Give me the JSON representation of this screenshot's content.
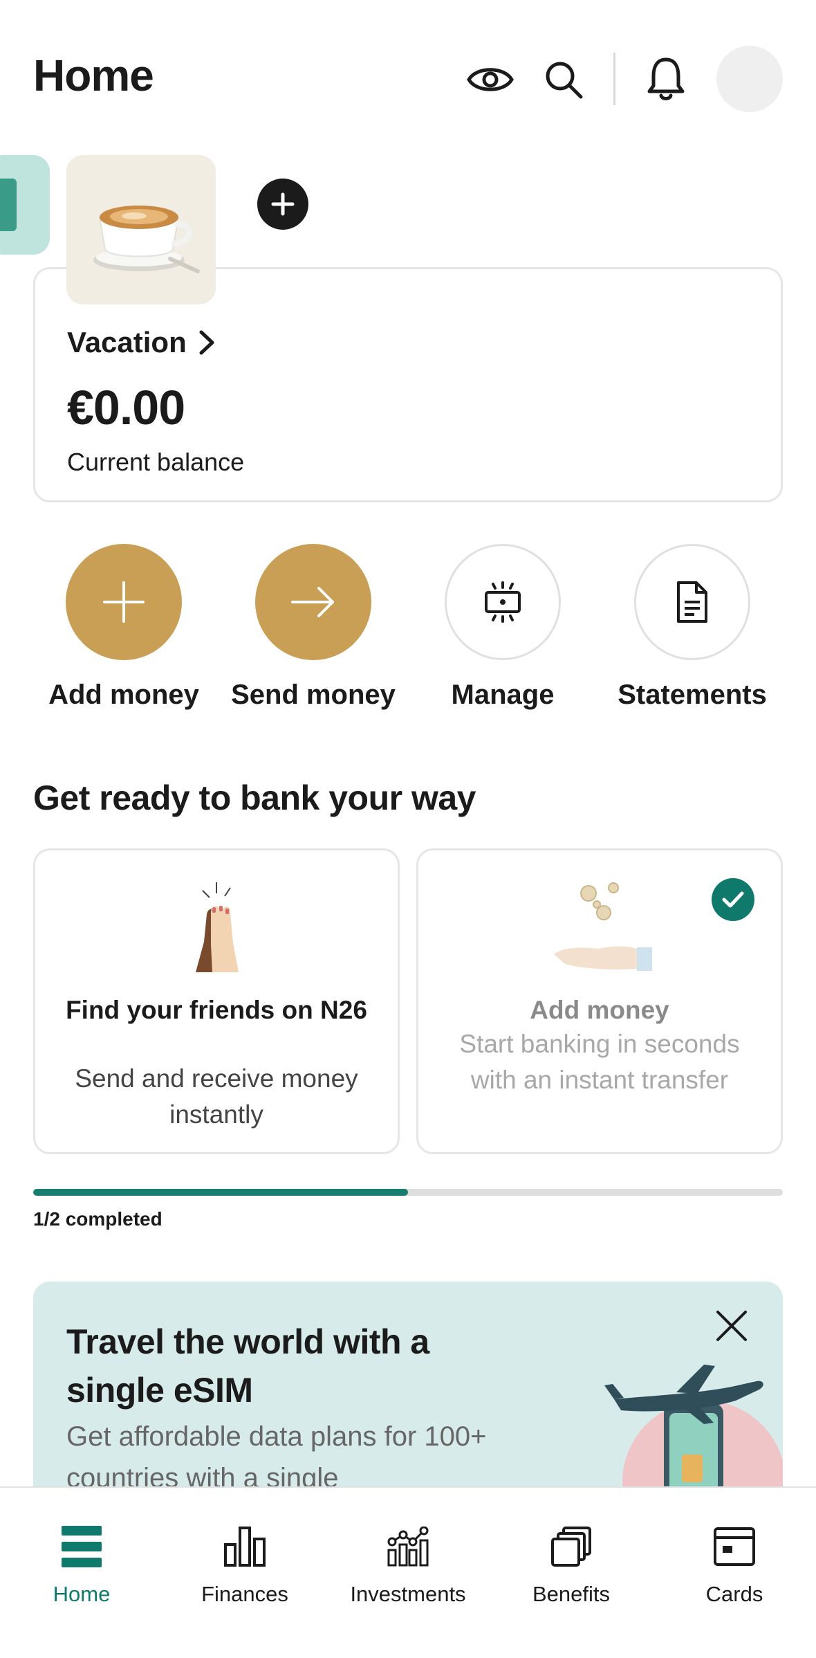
{
  "header": {
    "title": "Home"
  },
  "space_card": {
    "name": "Vacation",
    "balance": "€0.00",
    "balance_label": "Current balance"
  },
  "actions": [
    {
      "label": "Add money"
    },
    {
      "label": "Send money"
    },
    {
      "label": "Manage"
    },
    {
      "label": "Statements"
    }
  ],
  "onboarding": {
    "title": "Get ready to bank your way",
    "cards": [
      {
        "title": "Find your friends on N26",
        "description": "Send and receive money instantly",
        "completed": false
      },
      {
        "title": "Add money",
        "description": "Start banking in seconds with an instant transfer",
        "completed": true
      }
    ],
    "progress_fraction": 0.5,
    "progress_label": "1/2 completed"
  },
  "promo": {
    "title": "Travel the world with a single eSIM",
    "description": "Get affordable data plans for 100+ countries with a single"
  },
  "bottom_nav": [
    {
      "label": "Home",
      "active": true
    },
    {
      "label": "Finances",
      "active": false
    },
    {
      "label": "Investments",
      "active": false
    },
    {
      "label": "Benefits",
      "active": false
    },
    {
      "label": "Cards",
      "active": false
    }
  ],
  "colors": {
    "accent_gold": "#c99e55",
    "brand_teal": "#0f7a6c",
    "promo_background": "#d7ecea",
    "text": "#1b1b1b"
  }
}
